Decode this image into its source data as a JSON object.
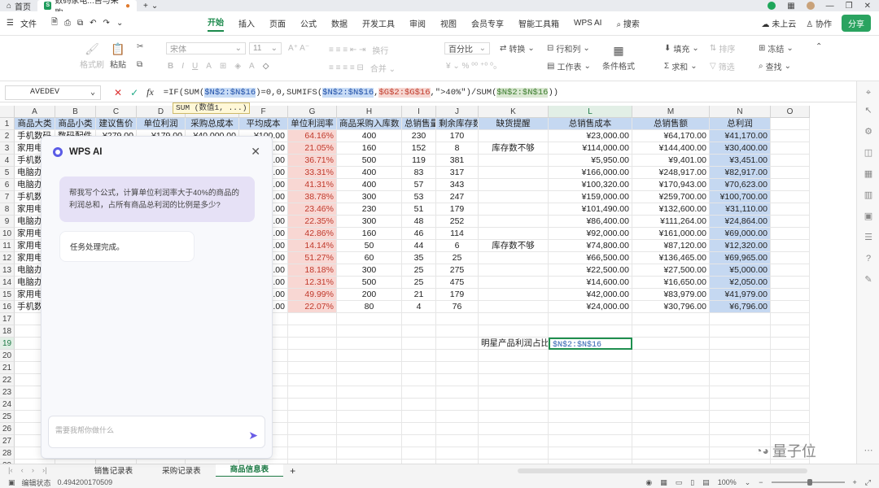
{
  "tabs": {
    "home": "首页",
    "doc": "数码家电...售与采购"
  },
  "menu": {
    "file": "文件",
    "items": [
      "开始",
      "插入",
      "页面",
      "公式",
      "数据",
      "开发工具",
      "审阅",
      "视图",
      "会员专享",
      "智能工具箱",
      "WPS AI"
    ],
    "active_index": 0,
    "search": "搜索",
    "cloud": "未上云",
    "collab": "协作",
    "share": "分享"
  },
  "ribbon": {
    "format_painter": "格式刷",
    "paste": "粘贴",
    "font": "宋体",
    "font_size": "11",
    "align_wrap": "换行",
    "merge": "合并",
    "number_format": "百分比",
    "convert": "转换",
    "row_col": "行和列",
    "worksheet": "工作表",
    "cond_format": "条件格式",
    "fill": "填充",
    "sort": "排序",
    "freeze": "冻结",
    "sum": "求和",
    "filter": "筛选",
    "find": "查找"
  },
  "formula_bar": {
    "name_box": "AVEDEV",
    "formula_parts": [
      {
        "t": "=IF(SUM(",
        "s": ""
      },
      {
        "t": "$N$2:$N$16",
        "s": "r1"
      },
      {
        "t": ")=0,0,SUMIFS(",
        "s": ""
      },
      {
        "t": "$N$2:$N$16",
        "s": "r1"
      },
      {
        "t": ",",
        "s": ""
      },
      {
        "t": "$G$2:$G$16",
        "s": "r2"
      },
      {
        "t": ",\">40%\")/SUM(",
        "s": ""
      },
      {
        "t": "$N$2:$N$16",
        "s": "r3"
      },
      {
        "t": "))",
        "s": ""
      }
    ],
    "tooltip": "SUM (数值1, ...)"
  },
  "columns": [
    "A",
    "B",
    "C",
    "D",
    "E",
    "F",
    "G",
    "H",
    "I",
    "J",
    "K",
    "L",
    "M",
    "N",
    "O"
  ],
  "selected_column": "L",
  "selected_row": 19,
  "headers": [
    "商品大类",
    "商品小类",
    "建议售价",
    "单位利润",
    "采购总成本",
    "平均成本",
    "单位利润率",
    "商品采购入库数",
    "总销售量",
    "剩余库存数",
    "缺货提醒",
    "总销售成本",
    "总销售额",
    "总利润"
  ],
  "rows": [
    {
      "a": "手机数码",
      "b": "数码配件",
      "c": "¥279.00",
      "d": "¥179.00",
      "e": "¥40,000.00",
      "f": "¥100.00",
      "g": "64.16%",
      "h": "400",
      "i": "230",
      "j": "170",
      "k": "",
      "l": "¥23,000.00",
      "m": "¥64,170.00",
      "n": "¥41,170.00"
    },
    {
      "a": "家用电器",
      "b": "",
      "c": "",
      "d": "",
      "e": "",
      "f": "¥750.00",
      "g": "21.05%",
      "h": "160",
      "i": "152",
      "j": "8",
      "k": "库存数不够",
      "l": "¥114,000.00",
      "m": "¥144,400.00",
      "n": "¥30,400.00"
    },
    {
      "a": "手机数码",
      "b": "",
      "c": "",
      "d": "",
      "e": "",
      "f": "¥50.00",
      "g": "36.71%",
      "h": "500",
      "i": "119",
      "j": "381",
      "k": "",
      "l": "¥5,950.00",
      "m": "¥9,401.00",
      "n": "¥3,451.00"
    },
    {
      "a": "电脑办公",
      "b": "",
      "c": "",
      "d": "",
      "e": "",
      "f": "¥2,000.00",
      "g": "33.31%",
      "h": "400",
      "i": "83",
      "j": "317",
      "k": "",
      "l": "¥166,000.00",
      "m": "¥248,917.00",
      "n": "¥82,917.00"
    },
    {
      "a": "电脑办公",
      "b": "",
      "c": "",
      "d": "",
      "e": "",
      "f": "¥1,760.00",
      "g": "41.31%",
      "h": "400",
      "i": "57",
      "j": "343",
      "k": "",
      "l": "¥100,320.00",
      "m": "¥170,943.00",
      "n": "¥70,623.00"
    },
    {
      "a": "手机数码",
      "b": "",
      "c": "",
      "d": "",
      "e": "",
      "f": "¥3,000.00",
      "g": "38.78%",
      "h": "300",
      "i": "53",
      "j": "247",
      "k": "",
      "l": "¥159,000.00",
      "m": "¥259,700.00",
      "n": "¥100,700.00"
    },
    {
      "a": "家用电器",
      "b": "",
      "c": "",
      "d": "",
      "e": "",
      "f": "¥1,990.00",
      "g": "23.46%",
      "h": "230",
      "i": "51",
      "j": "179",
      "k": "",
      "l": "¥101,490.00",
      "m": "¥132,600.00",
      "n": "¥31,110.00"
    },
    {
      "a": "电脑办公",
      "b": "",
      "c": "",
      "d": "",
      "e": "",
      "f": "¥1,800.00",
      "g": "22.35%",
      "h": "300",
      "i": "48",
      "j": "252",
      "k": "",
      "l": "¥86,400.00",
      "m": "¥111,264.00",
      "n": "¥24,864.00"
    },
    {
      "a": "家用电器",
      "b": "",
      "c": "",
      "d": "",
      "e": "",
      "f": "¥2,000.00",
      "g": "42.86%",
      "h": "160",
      "i": "46",
      "j": "114",
      "k": "",
      "l": "¥92,000.00",
      "m": "¥161,000.00",
      "n": "¥69,000.00"
    },
    {
      "a": "家用电器",
      "b": "",
      "c": "",
      "d": "",
      "e": "",
      "f": "¥1,700.00",
      "g": "14.14%",
      "h": "50",
      "i": "44",
      "j": "6",
      "k": "库存数不够",
      "l": "¥74,800.00",
      "m": "¥87,120.00",
      "n": "¥12,320.00"
    },
    {
      "a": "家用电器",
      "b": "",
      "c": "",
      "d": "",
      "e": "",
      "f": "¥1,900.00",
      "g": "51.27%",
      "h": "60",
      "i": "35",
      "j": "25",
      "k": "",
      "l": "¥66,500.00",
      "m": "¥136,465.00",
      "n": "¥69,965.00"
    },
    {
      "a": "电脑办公",
      "b": "",
      "c": "",
      "d": "",
      "e": "",
      "f": "¥900.00",
      "g": "18.18%",
      "h": "300",
      "i": "25",
      "j": "275",
      "k": "",
      "l": "¥22,500.00",
      "m": "¥27,500.00",
      "n": "¥5,000.00"
    },
    {
      "a": "电脑办公",
      "b": "",
      "c": "",
      "d": "",
      "e": "",
      "f": "¥584.00",
      "g": "12.31%",
      "h": "500",
      "i": "25",
      "j": "475",
      "k": "",
      "l": "¥14,600.00",
      "m": "¥16,650.00",
      "n": "¥2,050.00"
    },
    {
      "a": "家用电器",
      "b": "",
      "c": "",
      "d": "",
      "e": "",
      "f": "¥2,000.00",
      "g": "49.99%",
      "h": "200",
      "i": "21",
      "j": "179",
      "k": "",
      "l": "¥42,000.00",
      "m": "¥83,979.00",
      "n": "¥41,979.00"
    },
    {
      "a": "手机数码",
      "b": "",
      "c": "",
      "d": "",
      "e": "",
      "f": "¥6,000.00",
      "g": "22.07%",
      "h": "80",
      "i": "4",
      "j": "76",
      "k": "",
      "l": "¥24,000.00",
      "m": "¥30,796.00",
      "n": "¥6,796.00"
    }
  ],
  "star_label": "明星产品利润占比:",
  "active_cell_text": "$N$2:$N$16",
  "ai": {
    "title": "WPS AI",
    "question": "帮我写个公式，计算单位利润率大于40%的商品的利润总和，占所有商品总利润的比例是多少?",
    "answer": "任务处理完成。",
    "input_placeholder": "需要我帮你做什么"
  },
  "sheets": [
    "销售记录表",
    "采购记录表",
    "商品信息表"
  ],
  "active_sheet": 2,
  "status": {
    "mode": "编辑状态",
    "value": "0.494200170509",
    "zoom": "100%"
  },
  "watermark": "量子位"
}
